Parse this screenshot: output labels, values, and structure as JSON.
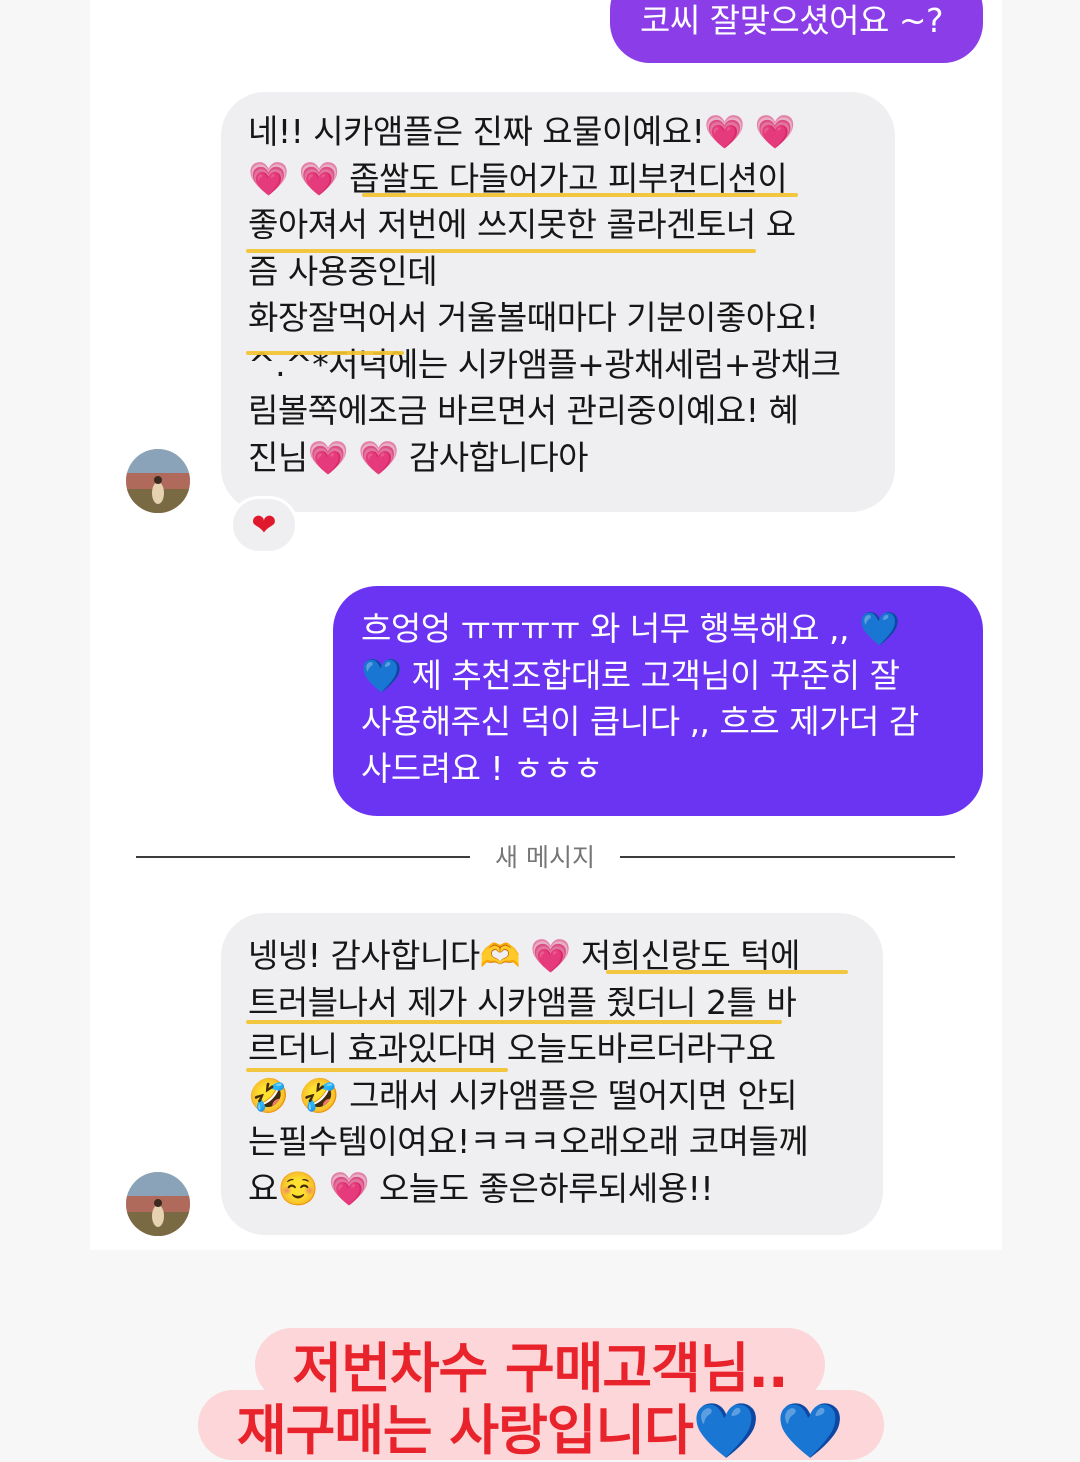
{
  "thread": {
    "top_sent_message": "코씨 잘맞으셨어요 ~?",
    "received_1": {
      "lines": [
        "네!! 시카앰플은 진짜 요물이예요!💗 💗",
        "💗 💗  좁쌀도 다들어가고 피부컨디션이",
        "좋아져서 저번에 쓰지못한 콜라겐토너 요",
        "즘 사용중인데",
        "화장잘먹어서 거울볼때마다 기분이좋아요!",
        "^.^*저녁에는 시카앰플+광채세럼+광채크",
        "림볼쪽에조금 바르면서 관리중이예요! 혜",
        "진님💗 💗 감사합니다아"
      ],
      "reaction": "❤"
    },
    "sent_2": {
      "lines": [
        "흐엉엉 ㅠㅠㅠㅠ 와 너무 행복해요 ,, 💙",
        "💙 제 추천조합대로 고객님이 꾸준히 잘",
        "사용해주신 덕이 큽니다 ,, 흐흐 제가더 감",
        "사드려요 ! ㅎㅎㅎ"
      ]
    },
    "divider_label": "새 메시지",
    "received_2": {
      "lines": [
        "넹넹! 감사합니다🫶 💗  저희신랑도 턱에",
        "트러블나서 제가 시카앰플 줬더니 2틀 바",
        "르더니 효과있다며 오늘도바르더라구요",
        "🤣 🤣  그래서 시카앰플은 떨어지면 안되",
        "는필수템이여요!ㅋㅋㅋ오래오래 코며들께",
        "요☺️ 💗  오늘도 좋은하루되세용!!"
      ]
    }
  },
  "banner": {
    "line1": "저번차수 구매고객님..",
    "line2": "재구매는 사랑입니다💙 💙"
  },
  "colors": {
    "sent_top_bubble": "#8b3ee8",
    "sent_bubble": "#6b34f2",
    "received_bubble": "#efeff1",
    "highlight_underline": "#f2c230",
    "banner_text": "#e8232b",
    "banner_bg": "#fcd6d8"
  }
}
